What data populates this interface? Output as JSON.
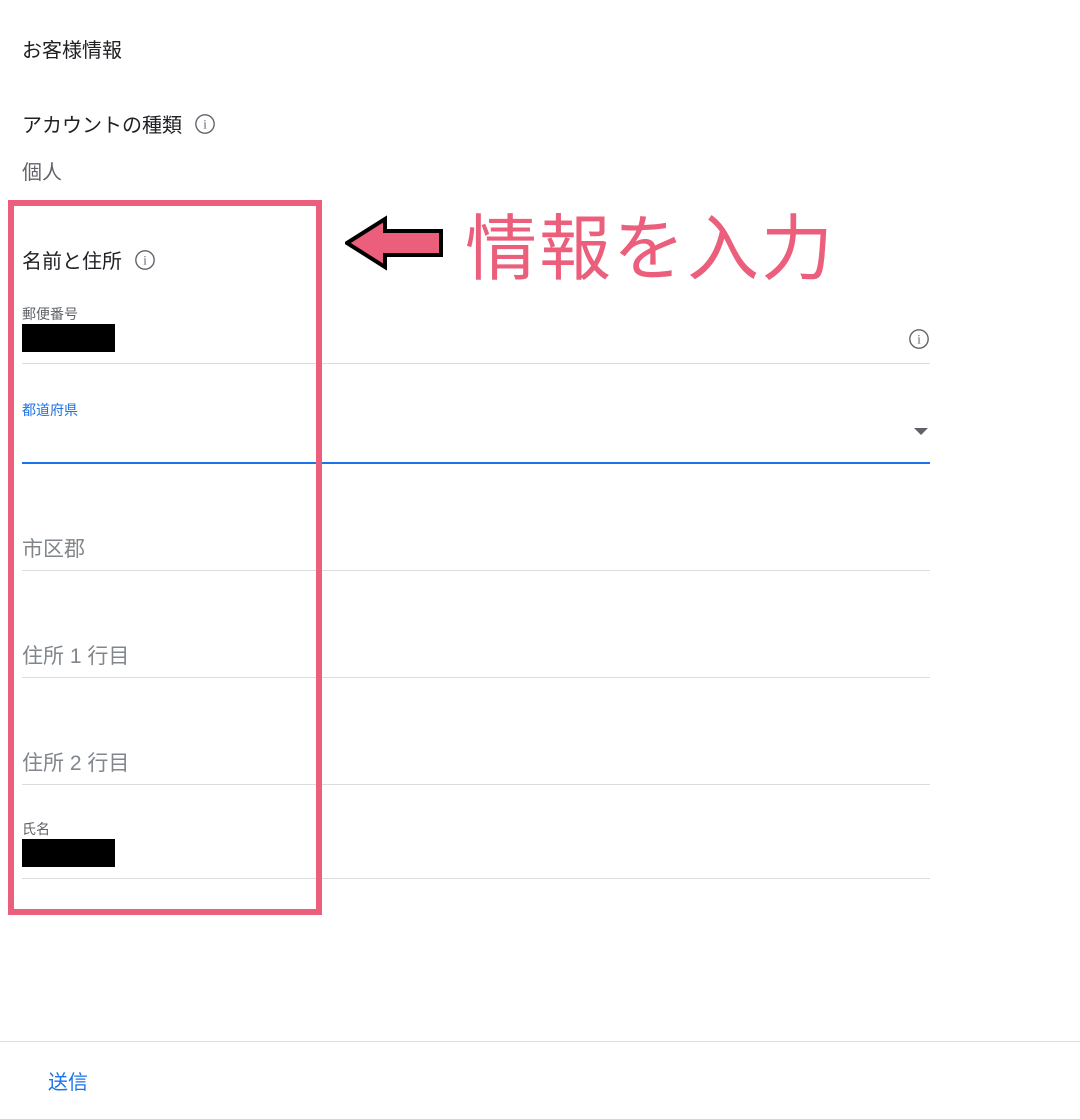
{
  "section_title": "お客様情報",
  "account_type": {
    "label": "アカウントの種類",
    "value": "個人"
  },
  "name_address_label": "名前と住所",
  "annotation_text": "情報を入力",
  "fields": {
    "postal_code": {
      "label": "郵便番号"
    },
    "prefecture": {
      "label": "都道府県",
      "value": ""
    },
    "city": {
      "placeholder": "市区郡",
      "value": ""
    },
    "addr1": {
      "placeholder": "住所 1 行目",
      "value": ""
    },
    "addr2": {
      "placeholder": "住所 2 行目",
      "value": ""
    },
    "name": {
      "label": "氏名"
    }
  },
  "footer": {
    "submit": "送信"
  },
  "icons": {
    "info_letter": "i"
  }
}
